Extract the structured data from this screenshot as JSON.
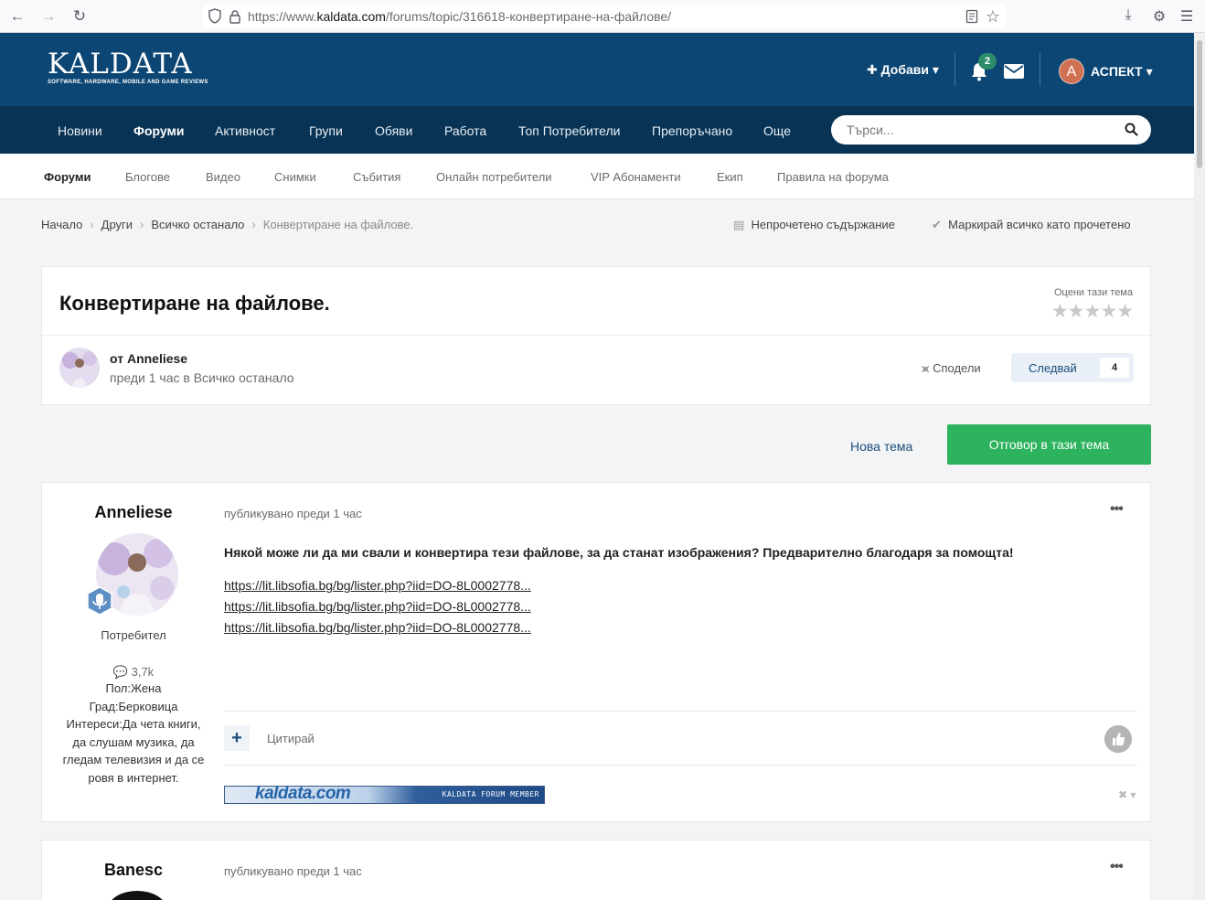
{
  "browser": {
    "url_prefix": "https://www.",
    "url_domain": "kaldata.com",
    "url_path": "/forums/topic/316618-конвертиране-на-файлове/"
  },
  "header": {
    "logo_main": "KALDATA",
    "logo_tagline": "SOFTWARE, HARDWARE, MOBILE AND GAME REVIEWS",
    "add_label": "Добави",
    "notification_count": "2",
    "user_initial": "A",
    "user_name": "АСПЕКТ"
  },
  "primary_nav": {
    "items": [
      "Новини",
      "Форуми",
      "Активност",
      "Групи",
      "Обяви",
      "Работа",
      "Топ Потребители",
      "Препоръчано",
      "Още"
    ],
    "active": "Форуми",
    "search_placeholder": "Търси..."
  },
  "secondary_nav": {
    "items": [
      "Форуми",
      "Блогове",
      "Видео",
      "Снимки",
      "Събития",
      "Онлайн потребители",
      "VIP Абонаменти",
      "Екип",
      "Правила на форума"
    ],
    "active": "Форуми"
  },
  "breadcrumb": {
    "items": [
      "Начало",
      "Други",
      "Всичко останало",
      "Конвертиране на файлове."
    ],
    "unread": "Непрочетено съдържание",
    "mark_read": "Маркирай всичко като прочетено"
  },
  "topic": {
    "title": "Конвертиране на файлове.",
    "rate_label": "Оцени тази тема",
    "author_prefix": "от ",
    "author": "Anneliese",
    "meta": "преди 1 час в Всичко останало",
    "share": "Сподели",
    "follow": "Следвай",
    "follow_count": "4"
  },
  "actions": {
    "new_topic": "Нова тема",
    "reply": "Отговор в тази тема"
  },
  "posts": [
    {
      "author": "Anneliese",
      "group": "Потребител",
      "post_count": "3,7k",
      "fields": [
        "Пол:Жена",
        "Град:Берковица",
        "Интереси:Да чета книги, да слушам музика, да гледам телевизия и да се ровя в интернет."
      ],
      "date": "публикувано преди 1 час",
      "body": "Някой може ли да ми свали и конвертира тези файлове, за да станат изображения? Предварително благодаря за помощта!",
      "links": [
        "https://lit.libsofia.bg/bg/lister.php?iid=DO-8L0002778...",
        "https://lit.libsofia.bg/bg/lister.php?iid=DO-8L0002778...",
        "https://lit.libsofia.bg/bg/lister.php?iid=DO-8L0002778..."
      ],
      "quote": "Цитирай",
      "signature_logo": "kaldata.com",
      "signature_text": "KALDATA FORUM MEMBER"
    },
    {
      "author": "Banesc",
      "date": "публикувано преди 1 час"
    }
  ],
  "colors": {
    "header_bg": "#0b4674",
    "nav_bg": "#083354",
    "reply_green": "#2db35d",
    "accent_link": "#1d4e7a"
  }
}
